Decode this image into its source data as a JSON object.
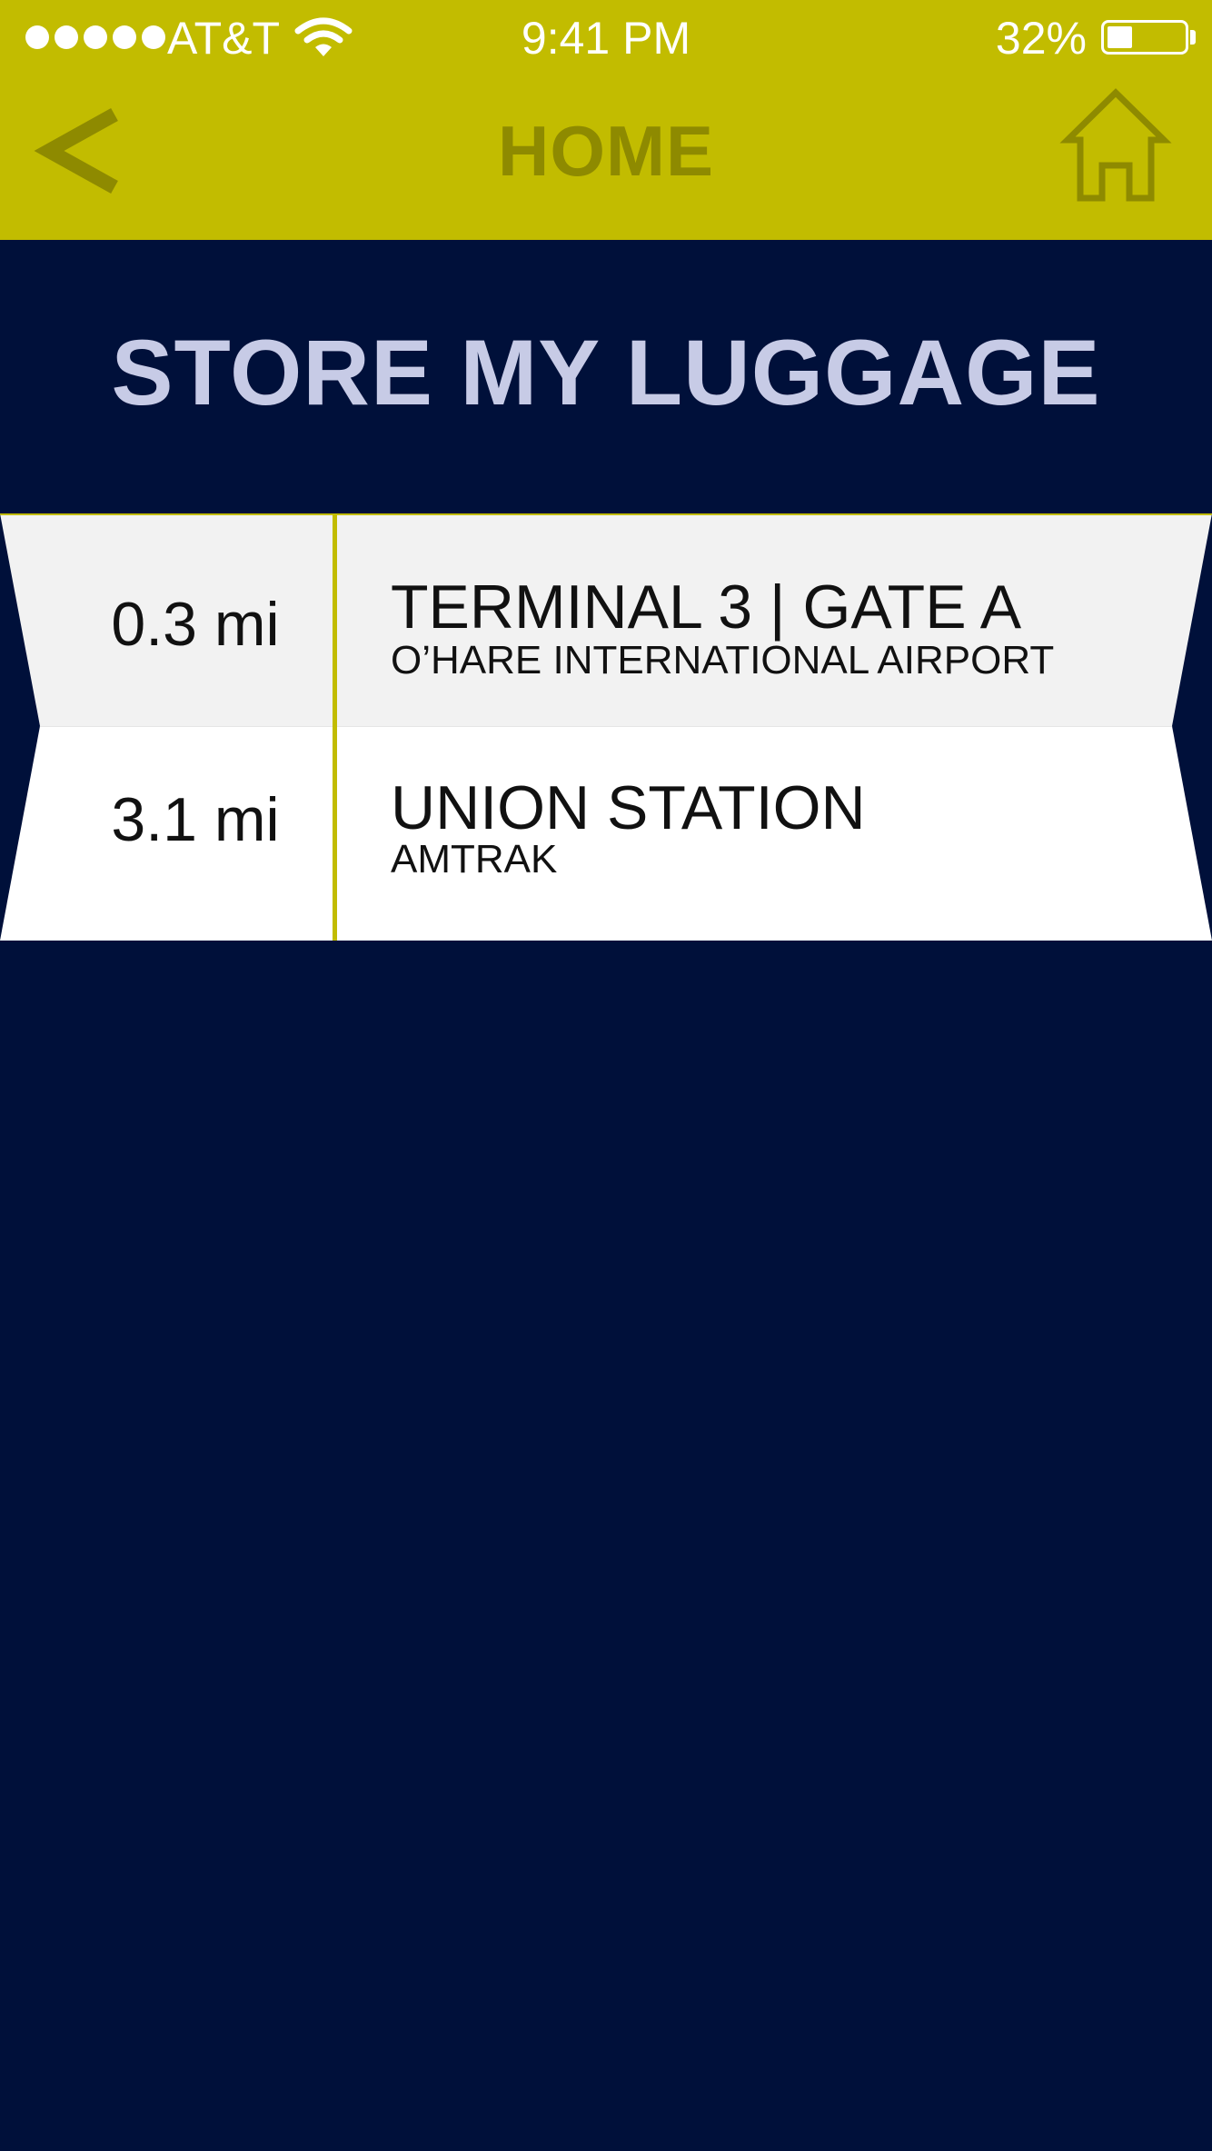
{
  "status_bar": {
    "carrier": "AT&T",
    "time": "9:41 PM",
    "battery_percent": "32%",
    "battery_level": 0.32,
    "signal_bars": 5,
    "signal_icon": "signal-dots-icon",
    "wifi_icon": "wifi-icon",
    "battery_icon": "battery-icon"
  },
  "nav": {
    "title": "HOME",
    "back_icon": "chevron-left-icon",
    "home_icon": "home-icon"
  },
  "page": {
    "title": "STORE MY LUGGAGE"
  },
  "locations": [
    {
      "distance": "0.3 mi",
      "name": "TERMINAL 3 | GATE A",
      "subtitle": "O’HARE INTERNATIONAL AIRPORT"
    },
    {
      "distance": "3.1 mi",
      "name": "UNION STATION",
      "subtitle": "AMTRAK"
    }
  ],
  "colors": {
    "header_bg": "#c2bc00",
    "nav_accent": "#8e8a00",
    "page_bg": "#00103a",
    "title_text": "#c7cbe6",
    "row_alt_bg": "#f2f2f2",
    "row_bg": "#ffffff"
  }
}
